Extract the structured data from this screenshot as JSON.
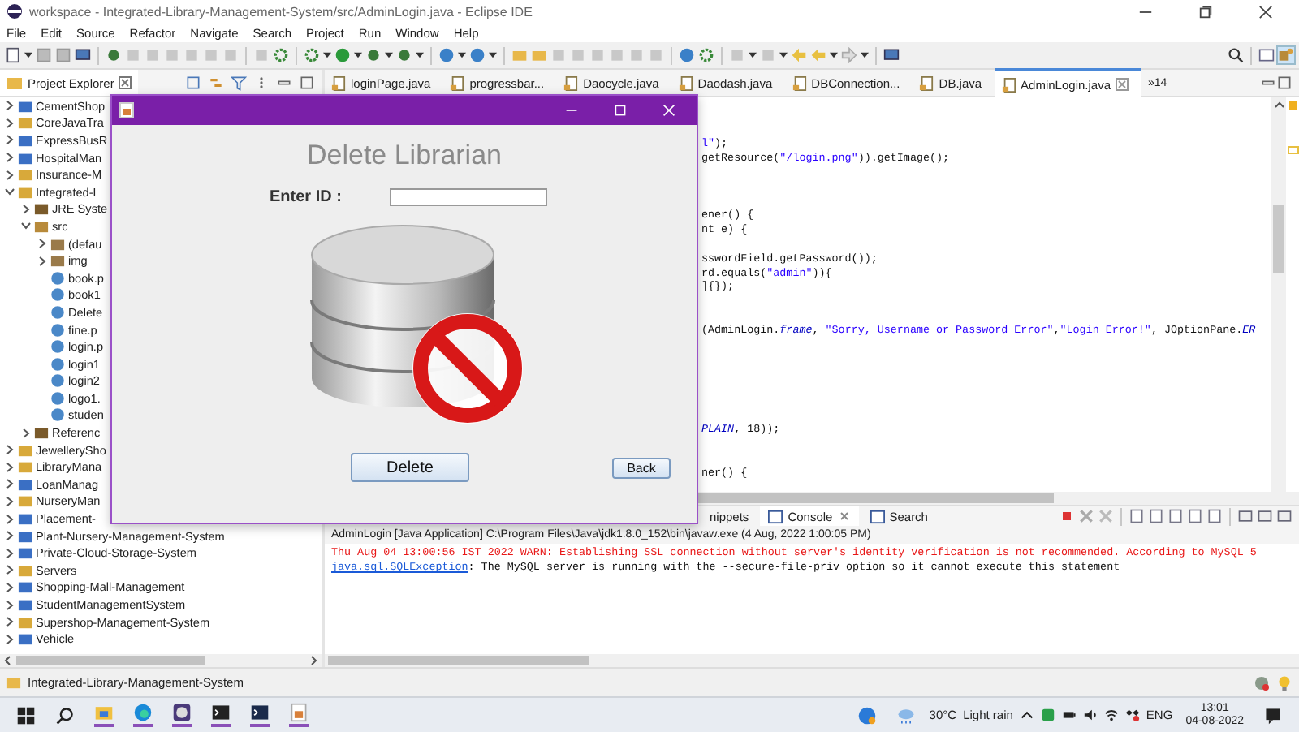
{
  "window": {
    "title": "workspace - Integrated-Library-Management-System/src/AdminLogin.java - Eclipse IDE"
  },
  "menu": [
    "File",
    "Edit",
    "Source",
    "Refactor",
    "Navigate",
    "Search",
    "Project",
    "Run",
    "Window",
    "Help"
  ],
  "explorer": {
    "title": "Project Explorer",
    "items": [
      {
        "label": "CementShop",
        "kind": "project",
        "expanded": false
      },
      {
        "label": "CoreJavaTra",
        "kind": "folder",
        "expanded": false
      },
      {
        "label": "ExpressBusR",
        "kind": "project",
        "expanded": false
      },
      {
        "label": "HospitalMan",
        "kind": "project",
        "expanded": false
      },
      {
        "label": "Insurance-M",
        "kind": "folder",
        "expanded": false
      },
      {
        "label": "Integrated-L",
        "kind": "folder",
        "expanded": true,
        "children": [
          {
            "label": "JRE Syste",
            "kind": "library",
            "expanded": false
          },
          {
            "label": "src",
            "kind": "source",
            "expanded": true,
            "children": [
              {
                "label": "(defau",
                "kind": "package",
                "expanded": false
              },
              {
                "label": "img",
                "kind": "package",
                "expanded": false
              },
              {
                "label": "book.p",
                "kind": "file"
              },
              {
                "label": "book1",
                "kind": "file"
              },
              {
                "label": "Delete",
                "kind": "file"
              },
              {
                "label": "fine.p",
                "kind": "file"
              },
              {
                "label": "login.p",
                "kind": "file"
              },
              {
                "label": "login1",
                "kind": "file"
              },
              {
                "label": "login2",
                "kind": "file"
              },
              {
                "label": "logo1.",
                "kind": "file"
              },
              {
                "label": "studen",
                "kind": "file"
              }
            ]
          },
          {
            "label": "Referenc",
            "kind": "library",
            "expanded": false
          }
        ]
      },
      {
        "label": "JewellerySho",
        "kind": "folder",
        "expanded": false
      },
      {
        "label": "LibraryMana",
        "kind": "folder",
        "expanded": false
      },
      {
        "label": "LoanManag",
        "kind": "project",
        "expanded": false
      },
      {
        "label": "NurseryMan",
        "kind": "folder",
        "expanded": false
      },
      {
        "label": "Placement-",
        "kind": "project",
        "expanded": false
      },
      {
        "label": "Plant-Nursery-Management-System",
        "kind": "project",
        "expanded": false
      },
      {
        "label": "Private-Cloud-Storage-System",
        "kind": "project",
        "expanded": false
      },
      {
        "label": "Servers",
        "kind": "folder",
        "expanded": false
      },
      {
        "label": "Shopping-Mall-Management",
        "kind": "project",
        "expanded": false
      },
      {
        "label": "StudentManagementSystem",
        "kind": "project",
        "expanded": false
      },
      {
        "label": "Supershop-Management-System",
        "kind": "folder",
        "expanded": false
      },
      {
        "label": "Vehicle",
        "kind": "project",
        "expanded": false
      }
    ]
  },
  "editor": {
    "tabs": [
      {
        "label": "loginPage.java",
        "selected": false
      },
      {
        "label": "progressbar...",
        "selected": false
      },
      {
        "label": "Daocycle.java",
        "selected": false
      },
      {
        "label": "Daodash.java",
        "selected": false
      },
      {
        "label": "DBConnection...",
        "selected": false
      },
      {
        "label": "DB.java",
        "selected": false
      },
      {
        "label": "AdminLogin.java",
        "selected": true
      }
    ],
    "overflow": "»14",
    "lines": [
      {
        "kind": "code",
        "segments": [
          {
            "kind": "string",
            "text": "l\""
          },
          {
            "kind": "plain",
            "text": ");"
          }
        ]
      },
      {
        "kind": "code",
        "segments": [
          {
            "kind": "plain",
            "text": "getResource("
          },
          {
            "kind": "string",
            "text": "\"/login.png\""
          },
          {
            "kind": "plain",
            "text": ")).getImage();"
          }
        ]
      },
      {
        "kind": "blank"
      },
      {
        "kind": "blank"
      },
      {
        "kind": "blank"
      },
      {
        "kind": "code",
        "segments": [
          {
            "kind": "plain",
            "text": "ener() {"
          }
        ]
      },
      {
        "kind": "code",
        "segments": [
          {
            "kind": "plain",
            "text": "nt e) {"
          }
        ]
      },
      {
        "kind": "blank"
      },
      {
        "kind": "code",
        "segments": [
          {
            "kind": "plain",
            "text": "sswordField.getPassword());"
          }
        ]
      },
      {
        "kind": "code",
        "segments": [
          {
            "kind": "plain",
            "text": "rd.equals("
          },
          {
            "kind": "string",
            "text": "\"admin\""
          },
          {
            "kind": "plain",
            "text": ")){"
          }
        ]
      },
      {
        "kind": "code",
        "segments": [
          {
            "kind": "plain",
            "text": "]{});"
          }
        ]
      },
      {
        "kind": "blank"
      },
      {
        "kind": "blank"
      },
      {
        "kind": "code",
        "segments": [
          {
            "kind": "plain",
            "text": "(AdminLogin."
          },
          {
            "kind": "field",
            "text": "frame"
          },
          {
            "kind": "plain",
            "text": ", "
          },
          {
            "kind": "string",
            "text": "\"Sorry, Username or Password Error\""
          },
          {
            "kind": "plain",
            "text": ","
          },
          {
            "kind": "string",
            "text": "\"Login Error!\""
          },
          {
            "kind": "plain",
            "text": ", JOptionPane."
          },
          {
            "kind": "field",
            "text": "ER"
          }
        ]
      },
      {
        "kind": "blank"
      },
      {
        "kind": "blank"
      },
      {
        "kind": "blank"
      },
      {
        "kind": "blank"
      },
      {
        "kind": "blank"
      },
      {
        "kind": "blank"
      },
      {
        "kind": "code",
        "segments": [
          {
            "kind": "field",
            "text": "PLAIN"
          },
          {
            "kind": "plain",
            "text": ", 18));"
          }
        ]
      },
      {
        "kind": "blank"
      },
      {
        "kind": "blank"
      },
      {
        "kind": "code",
        "segments": [
          {
            "kind": "plain",
            "text": "ner() {"
          }
        ]
      }
    ]
  },
  "console": {
    "tabs": [
      {
        "label": "nippets",
        "selected": false
      },
      {
        "label": "Console",
        "selected": true
      },
      {
        "label": "Search",
        "selected": false
      }
    ],
    "header": "AdminLogin [Java Application] C:\\Program Files\\Java\\jdk1.8.0_152\\bin\\javaw.exe  (4 Aug, 2022 1:00:05 PM)",
    "lines": [
      {
        "kind": "error",
        "segments": [
          {
            "kind": "text",
            "text": "Thu Aug 04 13:00:56 IST 2022 WARN: Establishing SSL connection without server's identity verification is not recommended. According to MySQL 5"
          }
        ]
      },
      {
        "kind": "normal",
        "segments": [
          {
            "kind": "link",
            "text": "java.sql.SQLException"
          },
          {
            "kind": "text",
            "text": ": The MySQL server is running with the --secure-file-priv option so it cannot execute this statement"
          }
        ]
      }
    ]
  },
  "dialog": {
    "heading": "Delete Librarian",
    "id_label": "Enter ID :",
    "buttons": [
      {
        "label": "Delete",
        "kind": "primary"
      },
      {
        "label": "Back",
        "kind": "secondary"
      }
    ]
  },
  "status_bar": {
    "project": "Integrated-Library-Management-System"
  },
  "taskbar": {
    "temperature": "30°C",
    "weather": "Light rain",
    "language": "ENG",
    "time": "13:01",
    "date": "04-08-2022"
  }
}
